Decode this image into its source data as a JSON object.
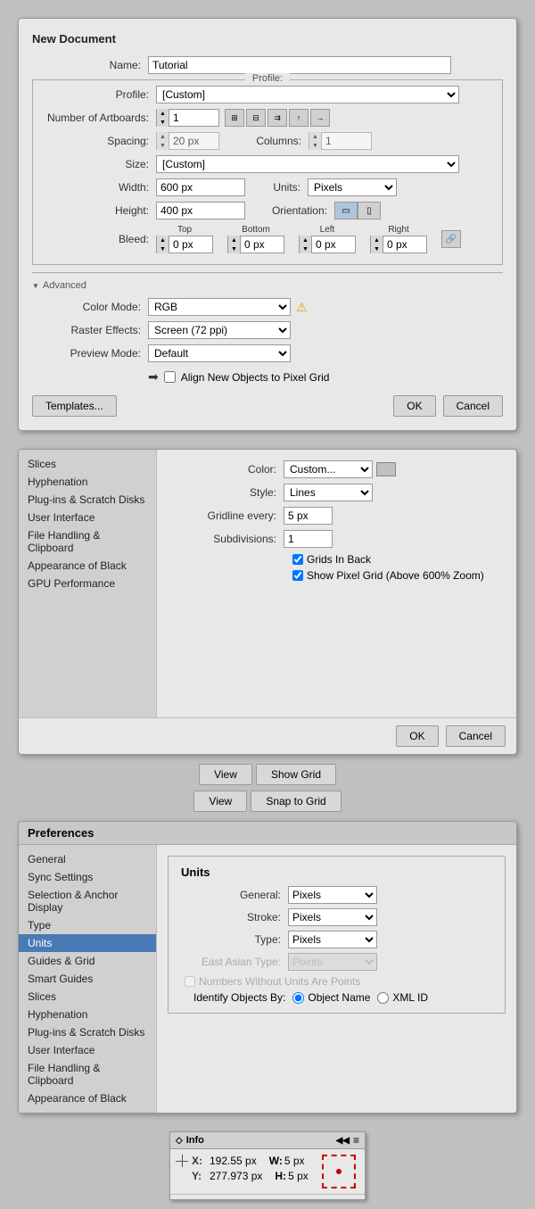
{
  "newDocument": {
    "title": "New Document",
    "nameLabel": "Name:",
    "nameValue": "Tutorial",
    "profileLabel": "Profile:",
    "profileValue": "[Custom]",
    "artboardsLabel": "Number of Artboards:",
    "artboardsValue": "1",
    "spacingLabel": "Spacing:",
    "spacingValue": "20 px",
    "columnsLabel": "Columns:",
    "columnsValue": "1",
    "sizeLabel": "Size:",
    "sizeValue": "[Custom]",
    "widthLabel": "Width:",
    "widthValue": "600 px",
    "unitsLabel": "Units:",
    "unitsValue": "Pixels",
    "heightLabel": "Height:",
    "heightValue": "400 px",
    "orientationLabel": "Orientation:",
    "bleedLabel": "Bleed:",
    "bleedTop": "Top",
    "bleedBottom": "Bottom",
    "bleedLeft": "Left",
    "bleedRight": "Right",
    "bleedTopVal": "0 px",
    "bleedBottomVal": "0 px",
    "bleedLeftVal": "0 px",
    "bleedRightVal": "0 px",
    "advancedLabel": "Advanced",
    "colorModeLabel": "Color Mode:",
    "colorModeValue": "RGB",
    "rasterLabel": "Raster Effects:",
    "rasterValue": "Screen (72 ppi)",
    "previewLabel": "Preview Mode:",
    "previewValue": "Default",
    "alignLabel": "Align New Objects to Pixel Grid",
    "templatesBtn": "Templates...",
    "okBtn": "OK",
    "cancelBtn": "Cancel"
  },
  "gridPrefs": {
    "sidebarItems": [
      {
        "label": "Slices",
        "active": false
      },
      {
        "label": "Hyphenation",
        "active": false
      },
      {
        "label": "Plug-ins & Scratch Disks",
        "active": false
      },
      {
        "label": "User Interface",
        "active": false
      },
      {
        "label": "File Handling & Clipboard",
        "active": false
      },
      {
        "label": "Appearance of Black",
        "active": false
      },
      {
        "label": "GPU Performance",
        "active": false
      }
    ],
    "colorLabel": "Color:",
    "colorValue": "Custom...",
    "styleLabel": "Style:",
    "styleValue": "Lines",
    "gridlineLabel": "Gridline every:",
    "gridlineValue": "5 px",
    "subdivLabel": "Subdivisions:",
    "subdivValue": "1",
    "gridsInBack": "Grids In Back",
    "showPixelGrid": "Show Pixel Grid (Above 600% Zoom)",
    "okBtn": "OK",
    "cancelBtn": "Cancel"
  },
  "viewButtons": [
    {
      "viewLabel": "View",
      "actionLabel": "Show Grid"
    },
    {
      "viewLabel": "View",
      "actionLabel": "Snap to Grid"
    }
  ],
  "unitsPrefs": {
    "title": "Preferences",
    "sidebarItems": [
      {
        "label": "General",
        "active": false
      },
      {
        "label": "Sync Settings",
        "active": false
      },
      {
        "label": "Selection & Anchor Display",
        "active": false
      },
      {
        "label": "Type",
        "active": false
      },
      {
        "label": "Units",
        "active": true
      },
      {
        "label": "Guides & Grid",
        "active": false
      },
      {
        "label": "Smart Guides",
        "active": false
      },
      {
        "label": "Slices",
        "active": false
      },
      {
        "label": "Hyphenation",
        "active": false
      },
      {
        "label": "Plug-ins & Scratch Disks",
        "active": false
      },
      {
        "label": "User Interface",
        "active": false
      },
      {
        "label": "File Handling & Clipboard",
        "active": false
      },
      {
        "label": "Appearance of Black",
        "active": false
      }
    ],
    "sectionTitle": "Units",
    "generalLabel": "General:",
    "generalValue": "Pixels",
    "strokeLabel": "Stroke:",
    "strokeValue": "Pixels",
    "typeLabel": "Type:",
    "typeValue": "Pixels",
    "eastAsianLabel": "East Asian Type:",
    "eastAsianValue": "Points",
    "numbersWithoutUnits": "Numbers Without Units Are Points",
    "identifyLabel": "Identify Objects By:",
    "objectNameOption": "Object Name",
    "xmlIdOption": "XML ID"
  },
  "infoPanel": {
    "title": "Info",
    "xLabel": "X:",
    "xValue": "192.55 px",
    "yLabel": "Y:",
    "yValue": "277.973 px",
    "wLabel": "W:",
    "wValue": "5 px",
    "hLabel": "H:",
    "hValue": "5 px",
    "collapseIcon": "◀◀",
    "menuIcon": "≡"
  }
}
